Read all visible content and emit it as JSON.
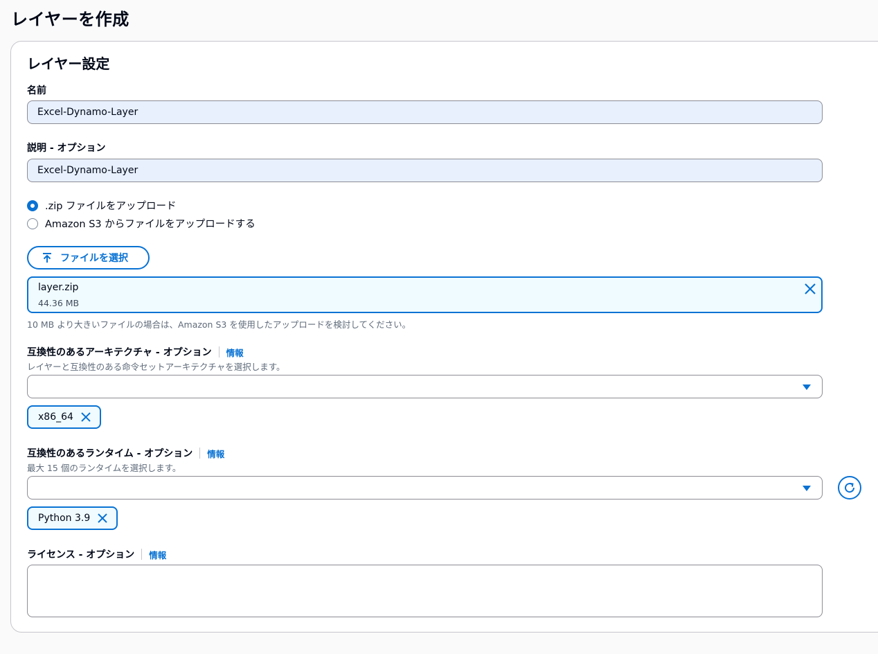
{
  "page": {
    "title": "レイヤーを作成"
  },
  "settings": {
    "section_title": "レイヤー設定",
    "name": {
      "label": "名前",
      "value": "Excel-Dynamo-Layer"
    },
    "description": {
      "label": "説明 - オプション",
      "value": "Excel-Dynamo-Layer"
    },
    "upload_options": [
      {
        "label": ".zip ファイルをアップロード",
        "selected": true
      },
      {
        "label": "Amazon S3 からファイルをアップロードする",
        "selected": false
      }
    ],
    "choose_file_button": "ファイルを選択",
    "file": {
      "name": "layer.zip",
      "size": "44.36 MB"
    },
    "file_hint": "10 MB より大きいファイルの場合は、Amazon S3 を使用したアップロードを検討してください。",
    "architectures": {
      "label": "互換性のあるアーキテクチャ - オプション",
      "info": "情報",
      "description": "レイヤーと互換性のある命令セットアーキテクチャを選択します。",
      "selected": [
        "x86_64"
      ]
    },
    "runtimes": {
      "label": "互換性のあるランタイム - オプション",
      "info": "情報",
      "description": "最大 15 個のランタイムを選択します。",
      "selected": [
        "Python 3.9"
      ]
    },
    "license": {
      "label": "ライセンス - オプション",
      "info": "情報",
      "value": ""
    }
  },
  "colors": {
    "accent": "#0972d3",
    "token_bg": "#f0fbff",
    "filled_input": "#e8f0fe"
  },
  "icons": [
    "upload-icon",
    "close-icon",
    "caret-down-icon",
    "refresh-icon"
  ]
}
